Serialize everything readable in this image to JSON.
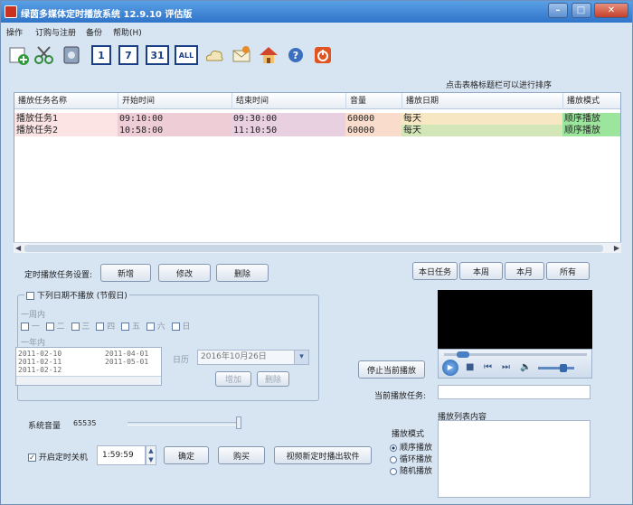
{
  "window": {
    "title": "绿茵多媒体定时播放系统 12.9.10 评估版"
  },
  "menu": [
    "操作",
    "订购与注册",
    "备份",
    "帮助(H)"
  ],
  "toolbar": {
    "date_buttons": [
      "1",
      "7",
      "31",
      "ALL"
    ]
  },
  "grid": {
    "hint": "点击表格标题栏可以进行排序",
    "columns": [
      "播放任务名称",
      "开始时间",
      "结束时间",
      "音量",
      "播放日期",
      "播放模式"
    ],
    "rows": [
      [
        "播放任务1",
        "09:10:00",
        "09:30:00",
        "60000",
        "每天",
        "顺序播放"
      ],
      [
        "播放任务2",
        "10:58:00",
        "11:10:50",
        "60000",
        "每天",
        "顺序播放"
      ]
    ]
  },
  "tasks": {
    "label": "定时播放任务设置:",
    "add": "新增",
    "edit": "修改",
    "delete": "删除"
  },
  "filters": {
    "today": "本日任务",
    "week": "本周",
    "month": "本月",
    "all": "所有"
  },
  "holiday": {
    "title": "下列日期不播放 (节假日)",
    "week_label": "一周内",
    "weekdays": [
      "一",
      "二",
      "三",
      "四",
      "五",
      "六",
      "日"
    ],
    "year_label": "一年内",
    "dates_col1": [
      "2011-02-10",
      "2011-02-11",
      "2011-02-12"
    ],
    "dates_col2": [
      "2011-04-01",
      "2011-05-01"
    ],
    "date_label": "日历",
    "date_value": "2016年10月26日",
    "add": "增加",
    "delete": "删除"
  },
  "player": {
    "stop": "停止当前播放",
    "current_label": "当前播放任务:",
    "playlist_label": "播放列表内容",
    "mode_label": "播放模式",
    "modes": [
      "顺序播放",
      "循环播放",
      "随机播放"
    ],
    "selected_mode": 0
  },
  "system": {
    "volume_label": "系统音量",
    "volume_value": "65535",
    "shutdown_label": "开启定时关机",
    "shutdown_time": "1:59:59",
    "confirm": "确定",
    "buy": "购买",
    "video_btn": "视频新定时播出软件"
  }
}
